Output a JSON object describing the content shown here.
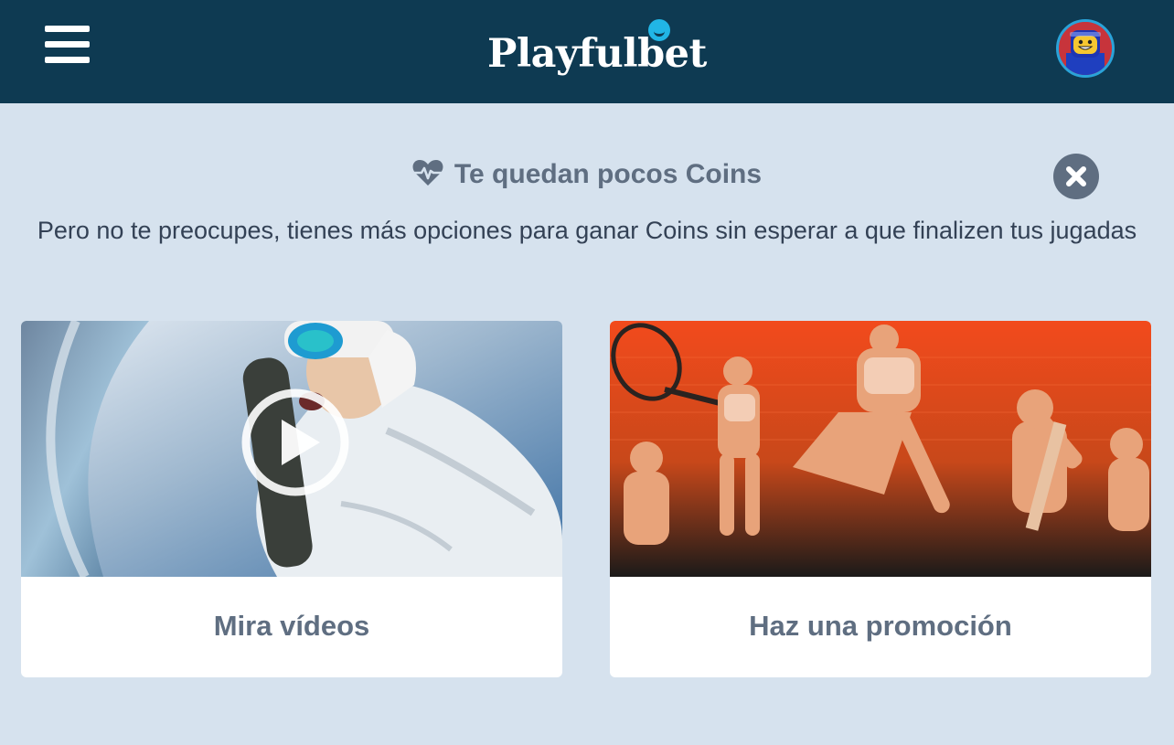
{
  "header": {
    "logo_text": "Playfulbet",
    "menu_icon": "hamburger-menu-icon",
    "avatar_icon": "user-avatar",
    "background": "#0e3a52",
    "logo_accent": "#21b6e6"
  },
  "alert": {
    "title": "Te quedan pocos Coins",
    "title_icon": "heartbeat-icon",
    "message": "Pero no te preocupes, tienes más opciones para ganar Coins sin esperar a que finalizen tus jugadas",
    "close_icon": "close-icon"
  },
  "options": [
    {
      "label": "Mira vídeos",
      "image": "snowboarder-selfie-photo",
      "overlay_icon": "play-icon"
    },
    {
      "label": "Haz una promoción",
      "image": "athletes-collage-orange-photo"
    }
  ],
  "colors": {
    "page_background": "#d6e2ee",
    "muted_text": "#5f6e81",
    "body_text": "#334155"
  }
}
